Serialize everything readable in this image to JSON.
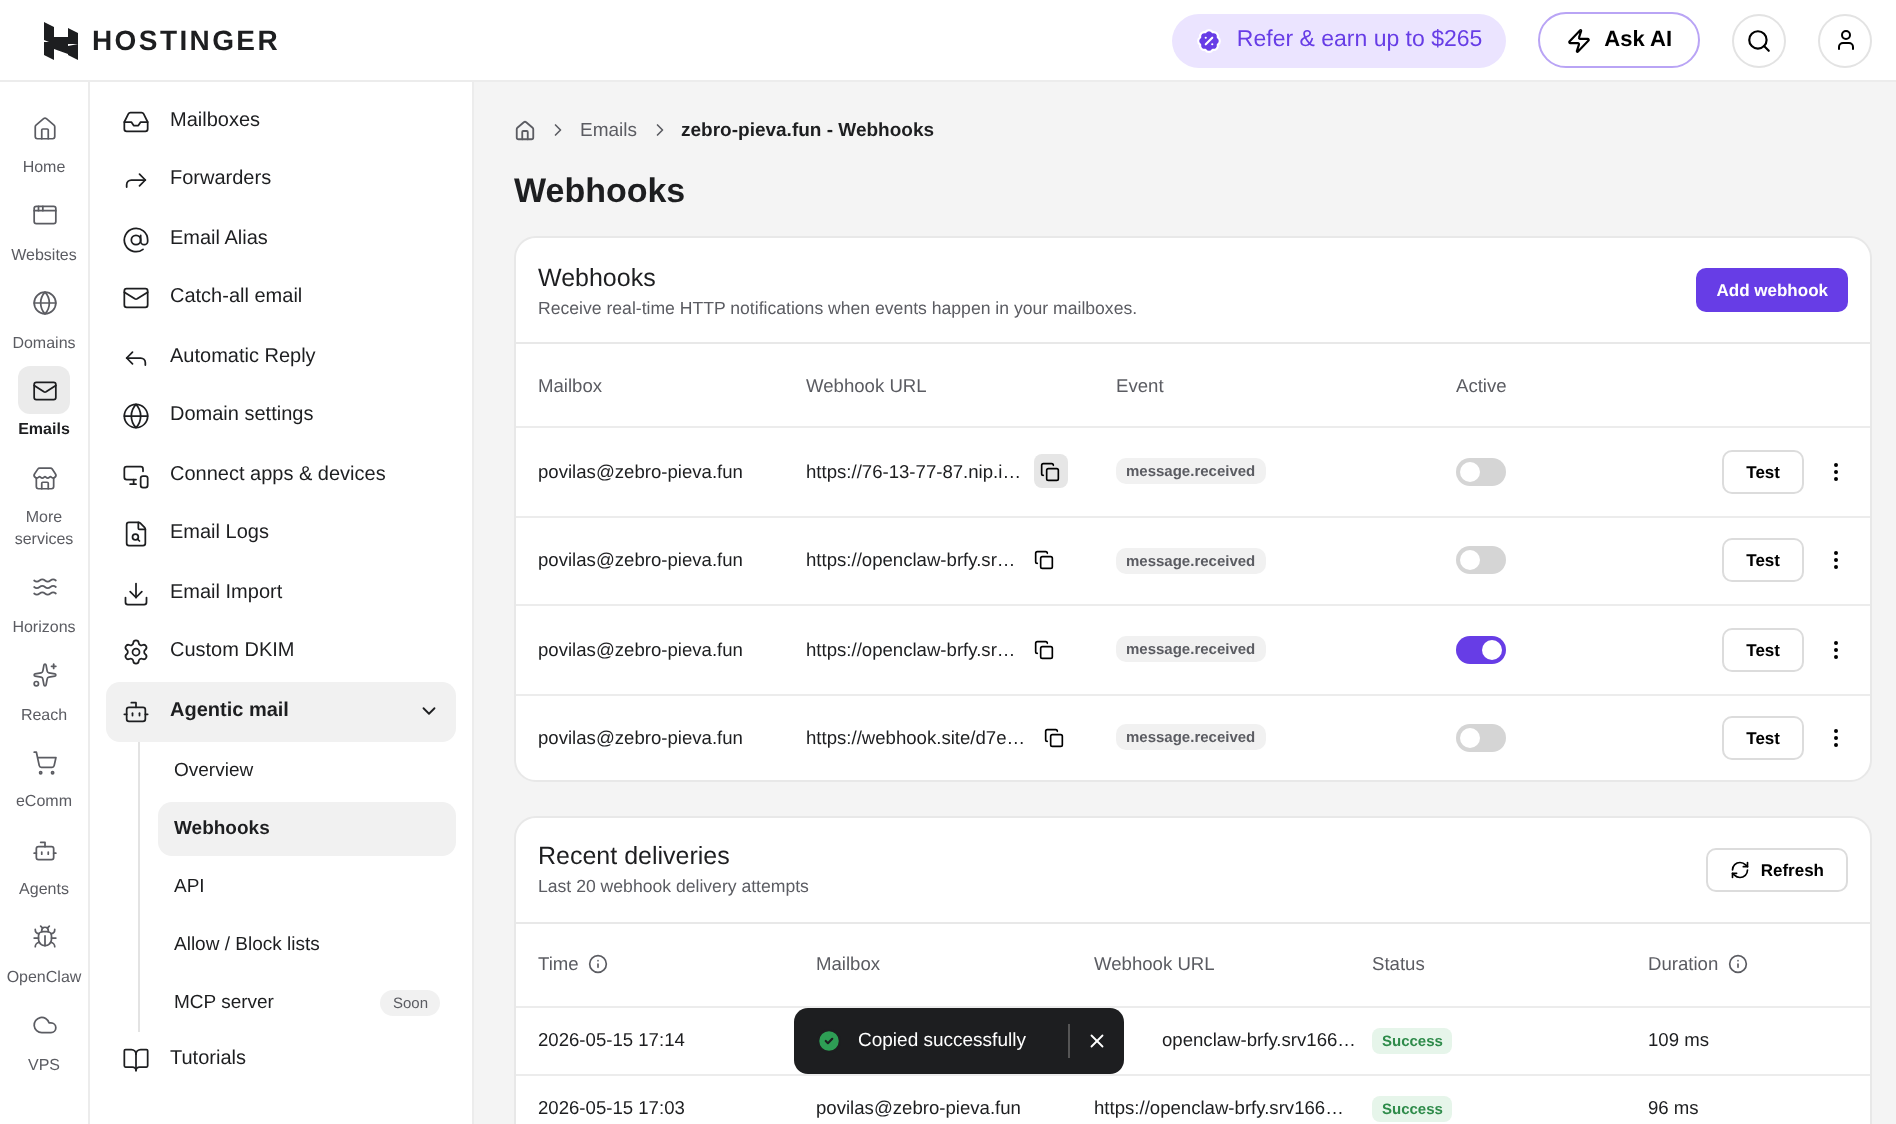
{
  "header": {
    "logo": "HOSTINGER",
    "refer": "Refer & earn up to $265",
    "ask_ai": "Ask AI"
  },
  "rail": [
    {
      "kind": "home",
      "label": "Home",
      "selected": false
    },
    {
      "kind": "websites",
      "label": "Websites",
      "selected": false
    },
    {
      "kind": "domains",
      "label": "Domains",
      "selected": false
    },
    {
      "kind": "emails",
      "label": "Emails",
      "selected": true
    },
    {
      "kind": "services",
      "label": "More services",
      "selected": false
    },
    {
      "kind": "horizons",
      "label": "Horizons",
      "selected": false
    },
    {
      "kind": "reach",
      "label": "Reach",
      "selected": false
    },
    {
      "kind": "ecomm",
      "label": "eComm",
      "selected": false
    },
    {
      "kind": "agents",
      "label": "Agents",
      "selected": false
    },
    {
      "kind": "openclaw",
      "label": "OpenClaw",
      "selected": false
    },
    {
      "kind": "vps",
      "label": "VPS",
      "selected": false
    }
  ],
  "sidebar": [
    {
      "kind": "mailboxes",
      "label": "Mailboxes",
      "selected": false
    },
    {
      "kind": "forwarders",
      "label": "Forwarders",
      "selected": false
    },
    {
      "kind": "alias",
      "label": "Email Alias",
      "selected": false
    },
    {
      "kind": "catchall",
      "label": "Catch-all email",
      "selected": false
    },
    {
      "kind": "reply",
      "label": "Automatic Reply",
      "selected": false
    },
    {
      "kind": "domain",
      "label": "Domain settings",
      "selected": false
    },
    {
      "kind": "connect",
      "label": "Connect apps & devices",
      "selected": false
    },
    {
      "kind": "logs",
      "label": "Email Logs",
      "selected": false
    },
    {
      "kind": "import",
      "label": "Email Import",
      "selected": false
    },
    {
      "kind": "dkim",
      "label": "Custom DKIM",
      "selected": false
    },
    {
      "kind": "agentic",
      "label": "Agentic mail",
      "selected": true,
      "expanded": true,
      "children": [
        {
          "label": "Overview",
          "selected": false
        },
        {
          "label": "Webhooks",
          "selected": true
        },
        {
          "label": "API",
          "selected": false
        },
        {
          "label": "Allow / Block lists",
          "selected": false
        },
        {
          "label": "MCP server",
          "selected": false,
          "badge": "Soon"
        }
      ]
    },
    {
      "kind": "tutorials",
      "label": "Tutorials",
      "selected": false
    }
  ],
  "breadcrumb": [
    "Emails",
    "zebro-pieva.fun - Webhooks"
  ],
  "page_title": "Webhooks",
  "webhooks": {
    "title": "Webhooks",
    "subtitle": "Receive real-time HTTP notifications when events happen in your mailboxes.",
    "add_button": "Add webhook",
    "columns": [
      "Mailbox",
      "Webhook URL",
      "Event",
      "Active"
    ],
    "rows": [
      {
        "mailbox": "povilas@zebro-pieva.fun",
        "url": "https://76-13-77-87.nip.i…",
        "copy_hovered": true,
        "event": "message.received",
        "active": false,
        "test": "Test"
      },
      {
        "mailbox": "povilas@zebro-pieva.fun",
        "url": "https://openclaw-brfy.sr…",
        "copy_hovered": false,
        "event": "message.received",
        "active": false,
        "test": "Test"
      },
      {
        "mailbox": "povilas@zebro-pieva.fun",
        "url": "https://openclaw-brfy.sr…",
        "copy_hovered": false,
        "event": "message.received",
        "active": true,
        "test": "Test"
      },
      {
        "mailbox": "povilas@zebro-pieva.fun",
        "url": "https://webhook.site/d7e…",
        "copy_hovered": false,
        "event": "message.received",
        "active": false,
        "test": "Test"
      }
    ]
  },
  "deliveries": {
    "title": "Recent deliveries",
    "subtitle": "Last 20 webhook delivery attempts",
    "refresh": "Refresh",
    "columns": [
      {
        "label": "Time",
        "info": true
      },
      {
        "label": "Mailbox",
        "info": false
      },
      {
        "label": "Webhook URL",
        "info": false
      },
      {
        "label": "Status",
        "info": false
      },
      {
        "label": "Duration",
        "info": true
      }
    ],
    "rows": [
      {
        "time": "2026-05-15 17:14",
        "under_toast": true,
        "url": "openclaw-brfy.srv166…",
        "status": "Success",
        "duration": "109 ms"
      },
      {
        "time": "2026-05-15 17:03",
        "under_toast": false,
        "mailbox": "povilas@zebro-pieva.fun",
        "url": "https://openclaw-brfy.srv166…",
        "status": "Success",
        "duration": "96 ms"
      }
    ]
  },
  "toast": {
    "message": "Copied successfully"
  }
}
